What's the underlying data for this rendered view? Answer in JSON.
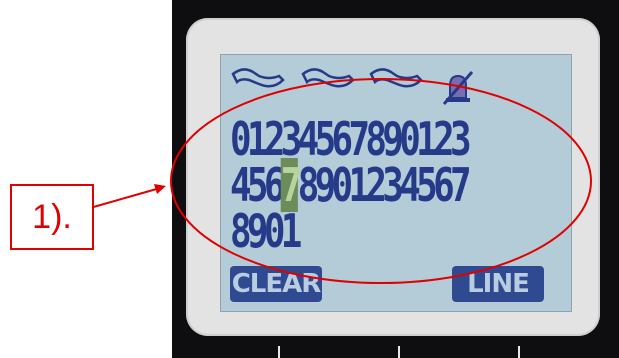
{
  "display": {
    "digit_lines": [
      {
        "text": "01234567890123"
      },
      {
        "before": "456",
        "cursor": "7",
        "after": "8901234567"
      },
      {
        "text": "8901"
      }
    ]
  },
  "softkeys": {
    "left": "CLEAR",
    "right": "LINE"
  },
  "status_icons": [
    "handset-icon",
    "handset-icon",
    "handset-icon",
    "bell-muted-icon"
  ],
  "annotation": {
    "label": "1).",
    "color": "#e00000"
  },
  "colors": {
    "screen": "#b4ccd8",
    "ink": "#253a88",
    "cursor": "#6c8c5c"
  }
}
